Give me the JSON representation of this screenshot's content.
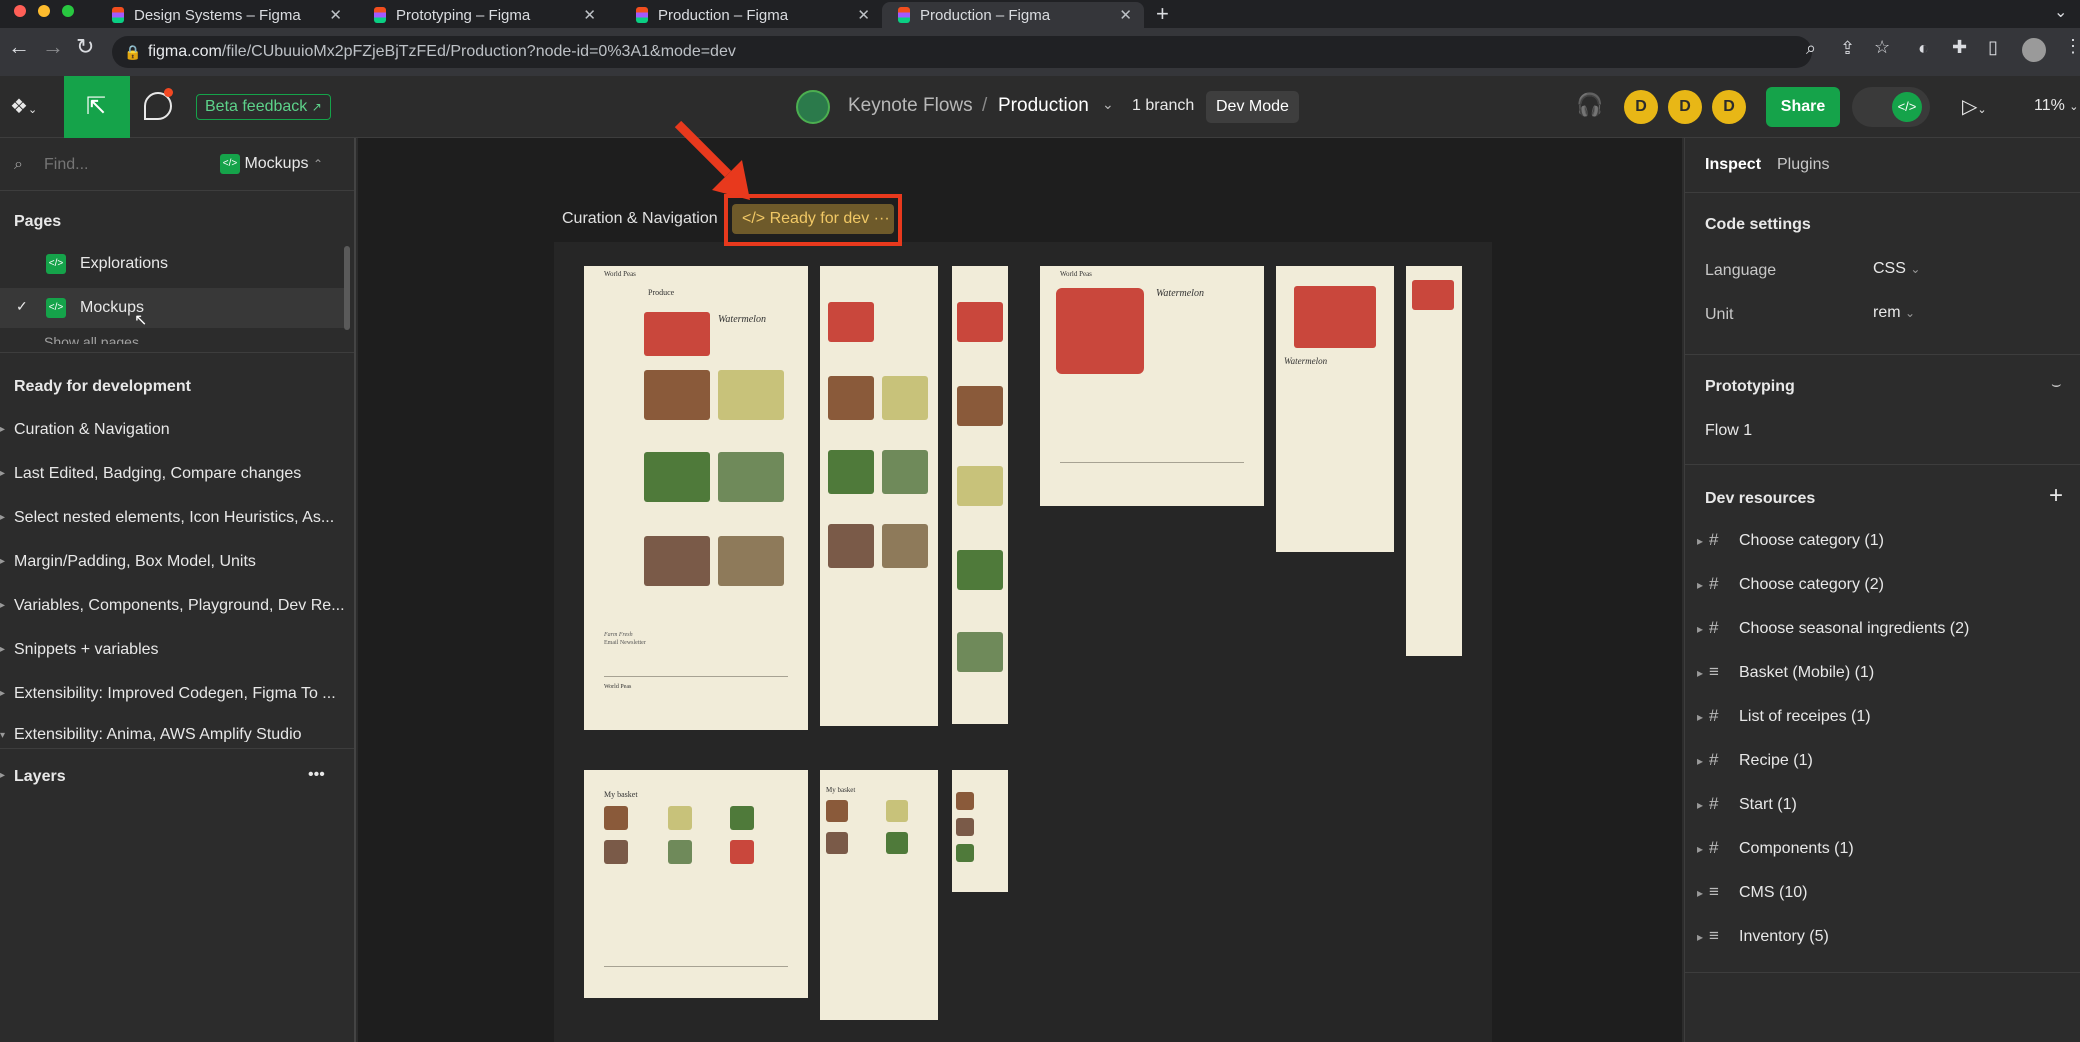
{
  "browser": {
    "tabs": [
      {
        "label": "Design Systems – Figma"
      },
      {
        "label": "Prototyping – Figma"
      },
      {
        "label": "Production – Figma"
      },
      {
        "label": "Production – Figma"
      }
    ],
    "url_host": "figma.com",
    "url_path": "/file/CUbuuioMx2pFZjeBjTzFEd/Production?node-id=0%3A1&mode=dev"
  },
  "toolbar": {
    "beta_feedback": "Beta feedback",
    "project": "Keynote Flows",
    "separator": "/",
    "file": "Production",
    "branch": "1 branch",
    "dev_mode": "Dev Mode",
    "avatars": [
      "D",
      "D",
      "D"
    ],
    "share": "Share",
    "zoom": "11%"
  },
  "left": {
    "find_placeholder": "Find...",
    "page_picker": "Mockups",
    "pages_header": "Pages",
    "pages": [
      {
        "label": "Explorations"
      },
      {
        "label": "Mockups"
      }
    ],
    "show_all": "Show all pages",
    "ready_header": "Ready for development",
    "ready_items": [
      "Curation & Navigation",
      "Last Edited, Badging, Compare changes",
      "Select nested elements, Icon Heuristics, As...",
      "Margin/Padding, Box Model, Units",
      "Variables, Components, Playground, Dev Re...",
      "Snippets + variables",
      "Extensibility: Improved Codegen, Figma To ...",
      "Extensibility: Anima, AWS Amplify Studio"
    ],
    "layers_header": "Layers",
    "more": "•••"
  },
  "canvas": {
    "section_label": "Curation & Navigation",
    "ready_badge": "Ready for dev",
    "badge_dots": "···",
    "mock_brand": "World Peas",
    "mock_product": "Watermelon",
    "mock_basket": "My basket",
    "mock_farm": "Farm Fresh",
    "mock_newsletter": "Email Newsletter",
    "mock_produce": "Produce"
  },
  "right": {
    "tabs": [
      "Inspect",
      "Plugins"
    ],
    "code_settings": "Code settings",
    "language_label": "Language",
    "language_value": "CSS",
    "unit_label": "Unit",
    "unit_value": "rem",
    "prototyping": "Prototyping",
    "flow": "Flow 1",
    "dev_resources": "Dev resources",
    "resources": [
      {
        "label": "Choose category (1)",
        "icon": "hash-icon"
      },
      {
        "label": "Choose category (2)",
        "icon": "hash-icon"
      },
      {
        "label": "Choose seasonal ingredients (2)",
        "icon": "hash-icon"
      },
      {
        "label": "Basket (Mobile) (1)",
        "icon": "lines-icon"
      },
      {
        "label": "List of receipes (1)",
        "icon": "hash-icon"
      },
      {
        "label": "Recipe (1)",
        "icon": "hash-icon"
      },
      {
        "label": "Start (1)",
        "icon": "hash-icon"
      },
      {
        "label": "Components (1)",
        "icon": "hash-icon"
      },
      {
        "label": "CMS (10)",
        "icon": "lines-icon"
      },
      {
        "label": "Inventory (5)",
        "icon": "lines-icon"
      }
    ]
  },
  "colors": {
    "accent_green": "#15a34a",
    "ready_orange": "#c8a24a",
    "highlight_red": "#e8391d",
    "avatar_yellow": "#e8b716"
  }
}
